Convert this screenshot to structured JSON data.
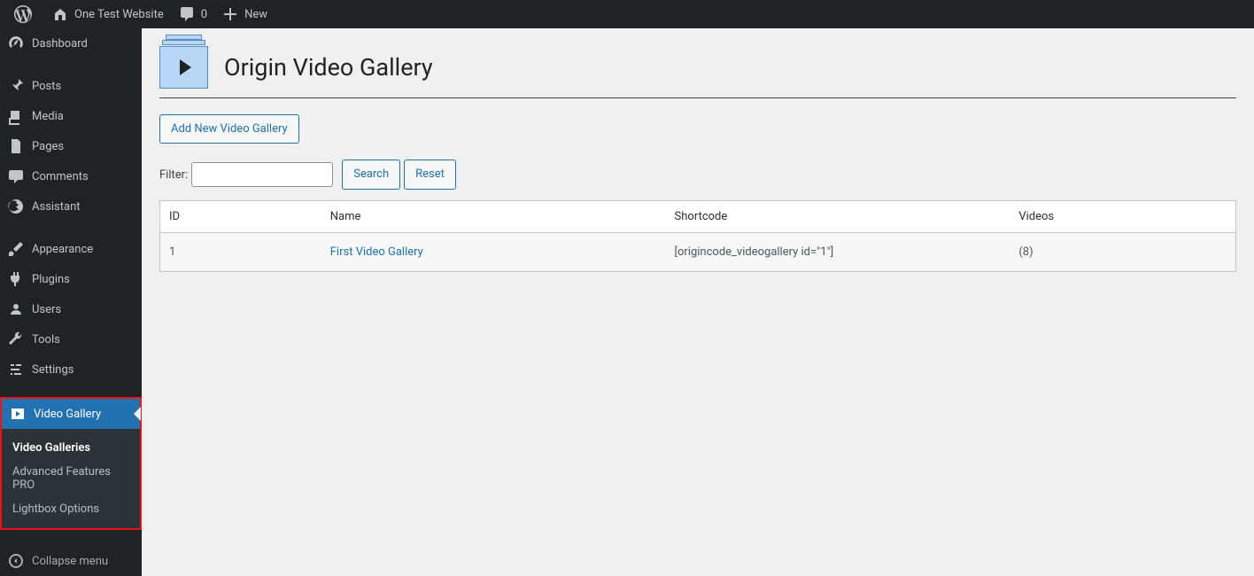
{
  "adminbar": {
    "site_name": "One Test Website",
    "comments_count": "0",
    "new_label": "New"
  },
  "sidebar": {
    "items": [
      {
        "label": "Dashboard"
      },
      {
        "label": "Posts"
      },
      {
        "label": "Media"
      },
      {
        "label": "Pages"
      },
      {
        "label": "Comments"
      },
      {
        "label": "Assistant"
      },
      {
        "label": "Appearance"
      },
      {
        "label": "Plugins"
      },
      {
        "label": "Users"
      },
      {
        "label": "Tools"
      },
      {
        "label": "Settings"
      },
      {
        "label": "Video Gallery"
      }
    ],
    "submenu": [
      {
        "label": "Video Galleries"
      },
      {
        "label": "Advanced Features PRO"
      },
      {
        "label": "Lightbox Options"
      }
    ],
    "collapse_label": "Collapse menu"
  },
  "page": {
    "title": "Origin Video Gallery",
    "add_button": "Add New Video Gallery",
    "filter_label": "Filter:",
    "search_btn": "Search",
    "reset_btn": "Reset"
  },
  "table": {
    "headers": {
      "id": "ID",
      "name": "Name",
      "shortcode": "Shortcode",
      "videos": "Videos"
    },
    "rows": [
      {
        "id": "1",
        "name": "First Video Gallery",
        "shortcode": "[origincode_videogallery id=\"1\"]",
        "videos": "(8)"
      }
    ]
  }
}
